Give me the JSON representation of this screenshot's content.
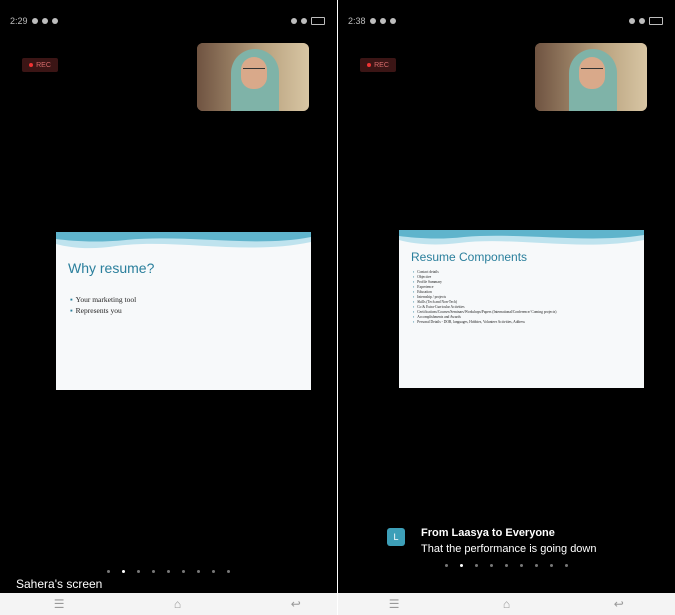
{
  "left": {
    "status": {
      "time": "2:29"
    },
    "rec_label": "REC",
    "slide": {
      "title": "Why resume?",
      "bullets": [
        "Your marketing tool",
        "Represents you"
      ]
    },
    "pager": {
      "count": 9,
      "active": 1
    },
    "screen_label": "Sahera's screen"
  },
  "right": {
    "status": {
      "time": "2:38"
    },
    "rec_label": "REC",
    "slide": {
      "title": "Resume Components",
      "bullets": [
        "Contact details",
        "Objective",
        "Profile Summary",
        "Experience",
        "Education",
        "Internship / projects",
        "Skills (Tech and Non-Tech)",
        "Co & Extra-Curricular Activities",
        "Certifications/Courses/Seminars/Workshops/Papers (International/Conference/ Coming projects)",
        "Accomplishments and Awards",
        "Personal Details - DOB, languages, Hobbies, Volunteer Activities, Address"
      ]
    },
    "pager": {
      "count": 9,
      "active": 1
    },
    "chat": {
      "avatar_letter": "L",
      "from": "From Laasya to Everyone",
      "message": "That the performance is going down"
    }
  },
  "navbar": {
    "icons": [
      "menu-icon",
      "home-icon",
      "back-icon"
    ]
  },
  "colors": {
    "slide_accent": "#2a7f9c",
    "chat_avatar": "#3d9fb8"
  }
}
